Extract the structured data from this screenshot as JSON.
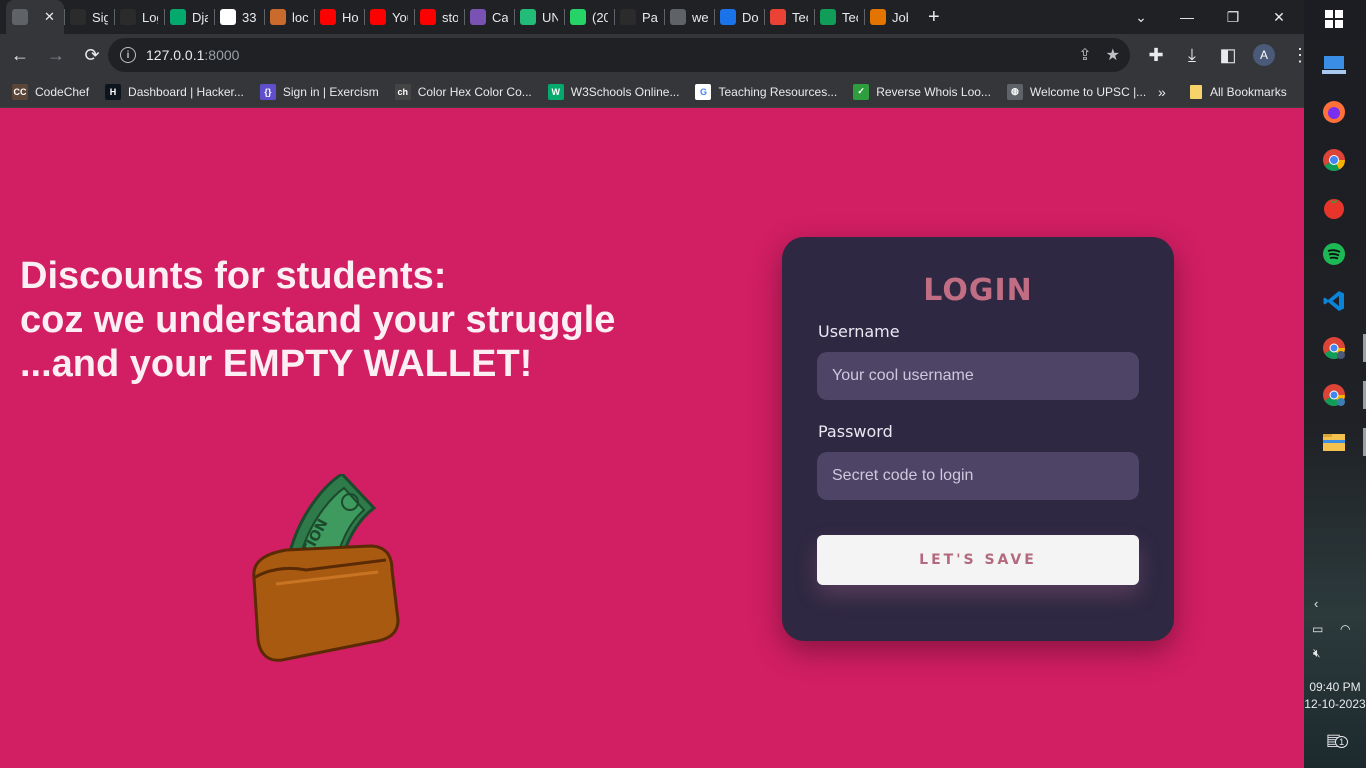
{
  "browser": {
    "tabs": [
      {
        "title": "",
        "icon": "globe-icon",
        "color": "#5f6368",
        "active": true
      },
      {
        "title": "Sig",
        "icon": "github-icon",
        "color": "#2b2b2b"
      },
      {
        "title": "Log",
        "icon": "github-icon",
        "color": "#2b2b2b"
      },
      {
        "title": "Dja",
        "icon": "w3-icon",
        "color": "#04aa6d"
      },
      {
        "title": "33",
        "icon": "f-icon",
        "color": "#ffffff"
      },
      {
        "title": "loc",
        "icon": "matlab-icon",
        "color": "#c96b2c"
      },
      {
        "title": "Ho",
        "icon": "youtube-icon",
        "color": "#ff0000"
      },
      {
        "title": "You",
        "icon": "youtube-icon",
        "color": "#ff0000"
      },
      {
        "title": "sto",
        "icon": "youtube-icon",
        "color": "#ff0000"
      },
      {
        "title": "Car",
        "icon": "bootstrap-icon",
        "color": "#7952b3"
      },
      {
        "title": "UN",
        "icon": "u-icon",
        "color": "#22bb77"
      },
      {
        "title": "(20",
        "icon": "whatsapp-icon",
        "color": "#25d366"
      },
      {
        "title": "Pag",
        "icon": "github-icon",
        "color": "#2b2b2b"
      },
      {
        "title": "wel",
        "icon": "globe-icon",
        "color": "#5f6368"
      },
      {
        "title": "Do",
        "icon": "download-icon",
        "color": "#1a73e8"
      },
      {
        "title": "Tec",
        "icon": "gmail-icon",
        "color": "#ea4335"
      },
      {
        "title": "Tec",
        "icon": "forms-icon",
        "color": "#0f9d58"
      },
      {
        "title": "Job",
        "icon": "stack-icon",
        "color": "#e37400"
      }
    ],
    "tab_close": "✕",
    "new_tab": "+",
    "address": {
      "host": "127.0.0.1",
      "port": ":8000"
    },
    "avatar_letter": "A",
    "bookmarks": [
      {
        "label": "CodeChef",
        "icon": "codechef-icon",
        "color": "#5b4638",
        "glyph": "CC"
      },
      {
        "label": "Dashboard | Hacker...",
        "icon": "hackerrank-icon",
        "color": "#0e141e",
        "glyph": "H"
      },
      {
        "label": "Sign in | Exercism",
        "icon": "exercism-icon",
        "color": "#604fcd",
        "glyph": "{}"
      },
      {
        "label": "Color Hex Color Co...",
        "icon": "colorhex-icon",
        "color": "#444444",
        "glyph": "ch"
      },
      {
        "label": "W3Schools Online...",
        "icon": "w3schools-icon",
        "color": "#04aa6d",
        "glyph": "W"
      },
      {
        "label": "Teaching Resources...",
        "icon": "google-icon",
        "color": "#ffffff",
        "glyph": "G"
      },
      {
        "label": "Reverse Whois Loo...",
        "icon": "check-icon",
        "color": "#2e9e3e",
        "glyph": "✓"
      },
      {
        "label": "Welcome to UPSC |...",
        "icon": "globe-icon",
        "color": "#5f6368",
        "glyph": "◍"
      }
    ],
    "bookmarks_more": "»",
    "all_bookmarks": "All Bookmarks"
  },
  "page": {
    "headline": [
      "Discounts for students:",
      "coz we understand your struggle",
      "...and your EMPTY WALLET!"
    ],
    "login": {
      "title": "LOGIN",
      "username_label": "Username",
      "username_placeholder": "Your cool username",
      "password_label": "Password",
      "password_placeholder": "Secret code to login",
      "submit_label": "LET'S SAVE"
    },
    "colors": {
      "background": "#d21e63",
      "card": "#2e2842",
      "accent": "#c16d83",
      "input": "#4d4466"
    }
  },
  "taskbar": {
    "apps": [
      "windows-start-icon",
      "vscode-remote-icon",
      "firefox-icon",
      "chrome-icon",
      "tomato-timer-icon",
      "spotify-icon",
      "vscode-icon",
      "chrome-profile-icon",
      "chrome-profile-2-icon",
      "file-explorer-icon"
    ],
    "time": "09:40 PM",
    "date": "12-10-2023",
    "notification_count": "1"
  }
}
